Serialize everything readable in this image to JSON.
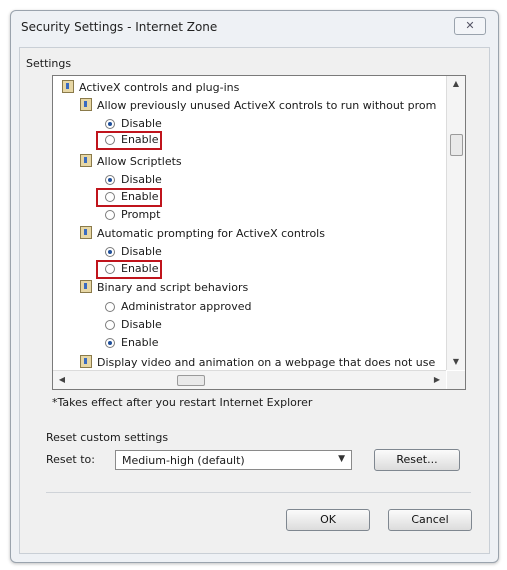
{
  "window": {
    "title": "Security Settings - Internet Zone",
    "close_symbol": "✕"
  },
  "settings_label": "Settings",
  "tree": {
    "group_activex": "ActiveX controls and plug-ins",
    "item1": {
      "label": "Allow previously unused ActiveX controls to run without prom",
      "options": [
        "Disable",
        "Enable"
      ],
      "selected": "Disable"
    },
    "item2": {
      "label": "Allow Scriptlets",
      "options": [
        "Disable",
        "Enable",
        "Prompt"
      ],
      "selected": "Disable"
    },
    "item3": {
      "label": "Automatic prompting for ActiveX controls",
      "options": [
        "Disable",
        "Enable"
      ],
      "selected": "Disable"
    },
    "item4": {
      "label": "Binary and script behaviors",
      "options": [
        "Administrator approved",
        "Disable",
        "Enable"
      ],
      "selected": "Enable"
    },
    "item5": {
      "label": "Display video and animation on a webpage that does not use"
    }
  },
  "highlight_color": "#c0141c",
  "note": "*Takes effect after you restart Internet Explorer",
  "reset": {
    "section_label": "Reset custom settings",
    "reset_to_label": "Reset to:",
    "dropdown_value": "Medium-high (default)",
    "reset_button": "Reset..."
  },
  "buttons": {
    "ok": "OK",
    "cancel": "Cancel"
  }
}
